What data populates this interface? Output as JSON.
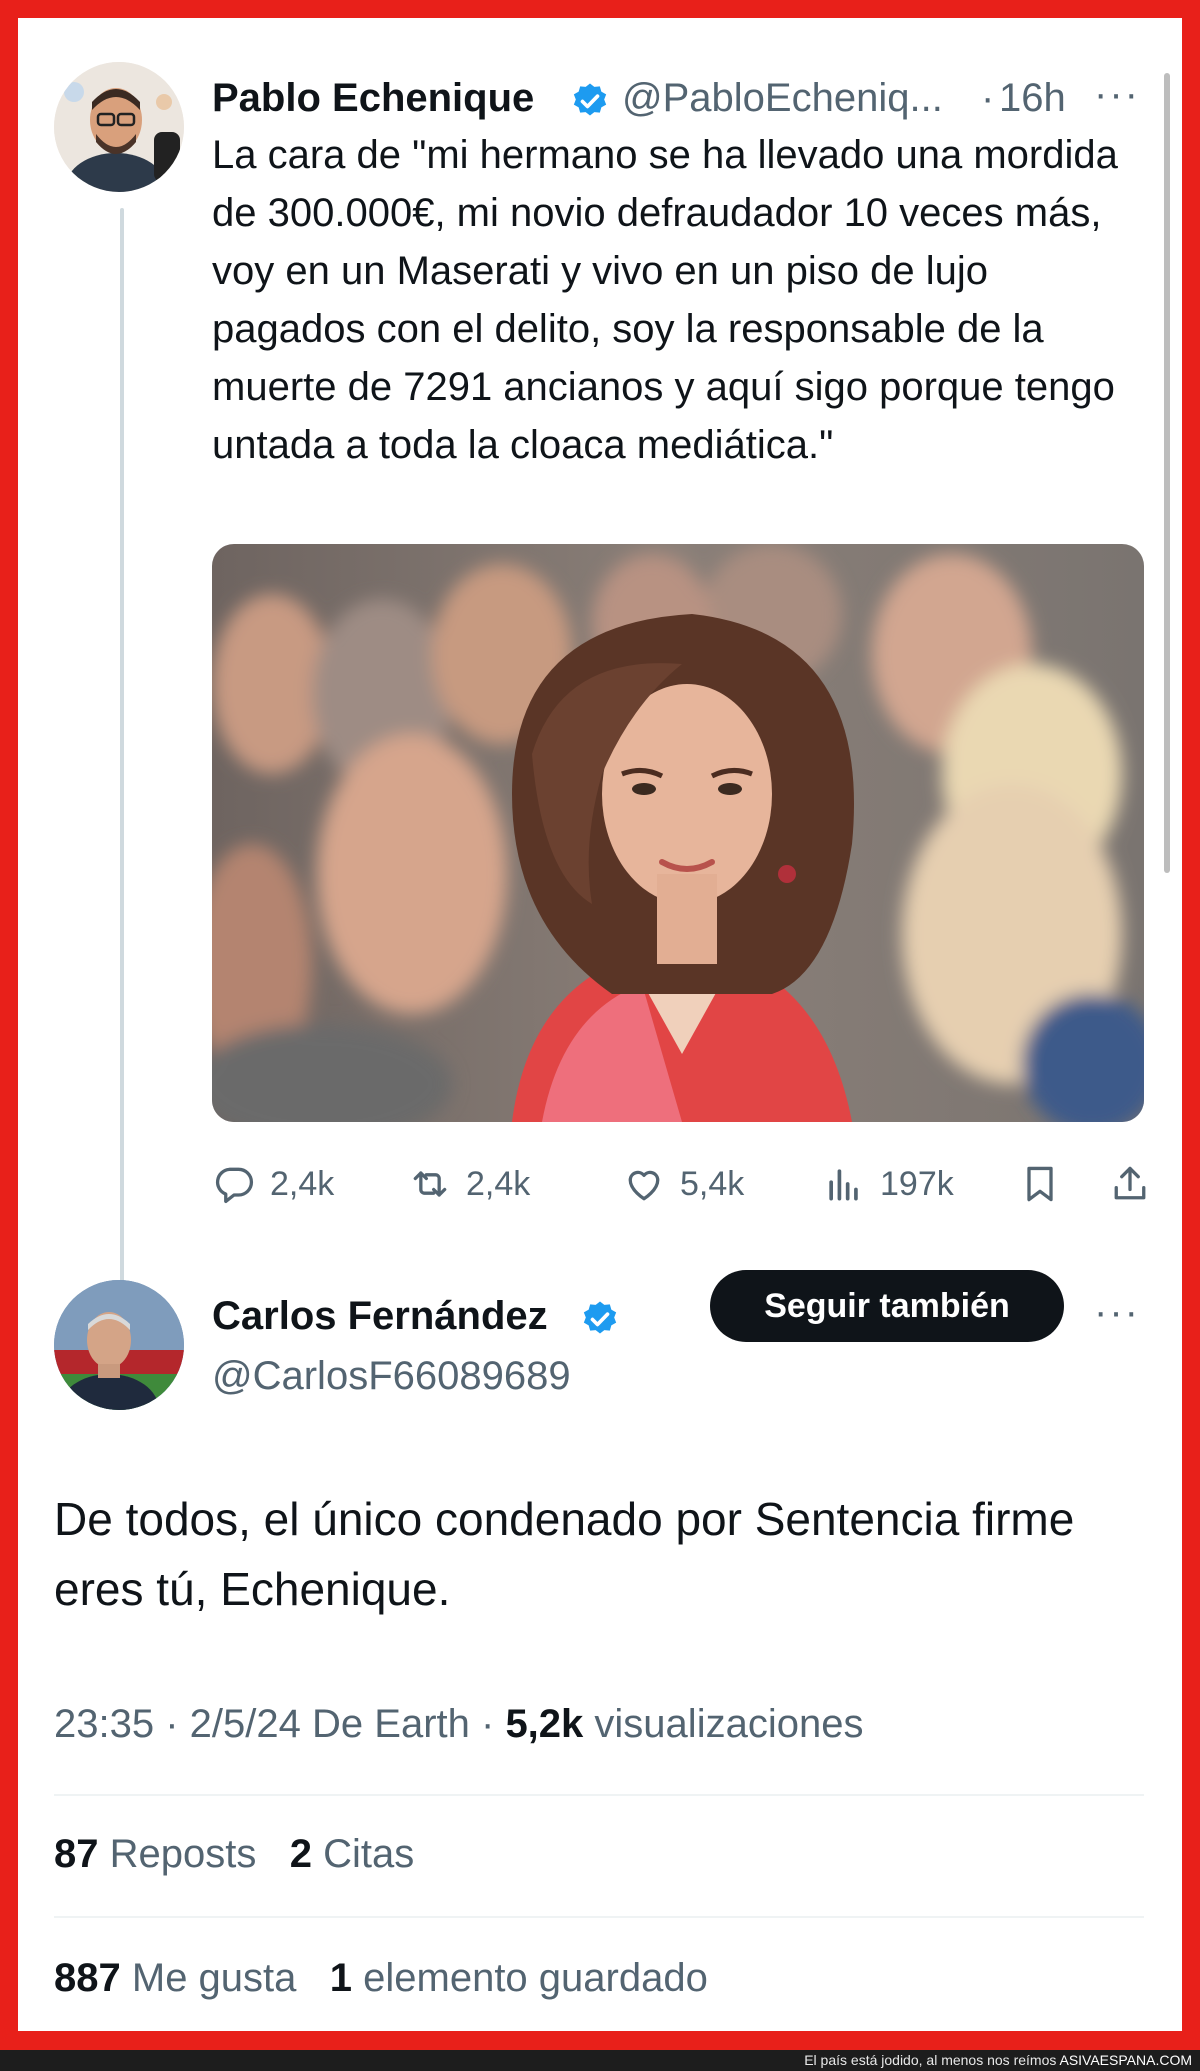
{
  "tweet": {
    "author_name": "Pablo Echenique",
    "handle": "@PabloEcheniq...",
    "time": "16h",
    "more": "···",
    "text": "La cara de \"mi hermano se ha llevado una mordida de 300.000€, mi novio defraudador 10 veces más, voy en un Maserati y vivo en un piso de lujo pagados con el delito, soy la responsable de la muerte de 7291 ancianos y aquí sigo porque tengo untada a toda la cloaca mediática.\"",
    "actions": {
      "replies": "2,4k",
      "reposts": "2,4k",
      "likes": "5,4k",
      "views": "197k"
    }
  },
  "reply": {
    "author_name": "Carlos Fernández",
    "handle": "@CarlosF66089689",
    "follow_label": "Seguir también",
    "more": "···",
    "text": "De todos, el único condenado por Sentencia firme eres tú,  Echenique.",
    "time": "23:35",
    "date": "2/5/24",
    "source": "De Earth",
    "views_count": "5,2k",
    "views_label": "visualizaciones",
    "reposts_count": "87",
    "reposts_label": "Reposts",
    "quotes_count": "2",
    "quotes_label": "Citas",
    "likes_count": "887",
    "likes_label": "Me gusta",
    "bookmarks_count": "1",
    "bookmarks_label": "elemento guardado"
  },
  "footer": {
    "caption": "El país está jodido, al menos nos reímos",
    "brand": "ASIVAESPANA.COM"
  },
  "colors": {
    "frame": "#e8201a",
    "verified": "#1d9bf0",
    "text": "#0f1419",
    "secondary": "#536471"
  }
}
